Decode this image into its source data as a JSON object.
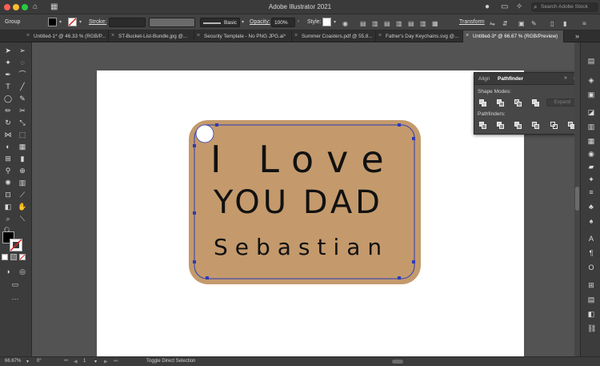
{
  "app": {
    "title": "Adobe Illustrator 2021"
  },
  "titlebar": {
    "search_placeholder": "Search Adobe Stock"
  },
  "control": {
    "selection": "Group",
    "stroke_label": "Stroke:",
    "stroke_profile": "Basic",
    "opacity_label": "Opacity:",
    "opacity_value": "100%",
    "style_label": "Style:",
    "transform_label": "Transform"
  },
  "tabs": [
    {
      "label": "Untitled-1* @ 46.33 % (RGB/P..."
    },
    {
      "label": "ST-Bucket-List-Bundle.jpg @..."
    },
    {
      "label": "Security Template - No PNG JPG.ai*"
    },
    {
      "label": "Summer Coasters.pdf @ 55.8..."
    },
    {
      "label": "Father's Day Keychains.svg @..."
    },
    {
      "label": "Untitled-3* @ 66.67 % (RGB/Preview)"
    }
  ],
  "panel": {
    "tabs": [
      "Align",
      "Pathfinder"
    ],
    "shape_modes_label": "Shape Modes:",
    "expand_label": "Expand",
    "pathfinders_label": "Pathfinders:"
  },
  "artwork": {
    "line1": "I Love",
    "line2": "YOU DAD",
    "line3": "Sebastian"
  },
  "status": {
    "zoom": "66.67%",
    "artboard_number": "1",
    "tool_hint": "Toggle Direct Selection"
  },
  "colors": {
    "keychain_fill": "#c49a6c",
    "path_outline": "#2b3bb8",
    "ink": "#111111"
  }
}
